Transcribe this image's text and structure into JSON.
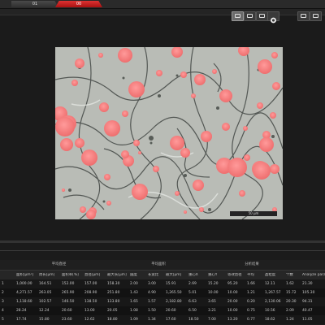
{
  "tabs": [
    {
      "label": "01"
    },
    {
      "label": "00"
    }
  ],
  "viewer": {
    "scale_label": "50 μm",
    "tool_icons": [
      "single-view-icon",
      "dual-view-icon",
      "grid-view-icon",
      "palette-icon",
      "save-image-icon",
      "settings-icon"
    ]
  },
  "table": {
    "groups": [
      "平均直径",
      "平均面积",
      "分析结果"
    ],
    "headers": [
      "",
      "面积[μm²]",
      "周长[μm]",
      "面积率[%]",
      "直径[μm]",
      "最大长[μm]",
      "圆度",
      "长宽比",
      "最大[μm]",
      "重心X",
      "重心Y",
      "等效直径",
      "平均",
      "晶粒度",
      "个数",
      "Analyze parameters"
    ],
    "rows": [
      [
        "1",
        "1,000.00",
        "164.51",
        "152.00",
        "157.00",
        "158.30",
        "2.00",
        "3.00",
        "15.91",
        "2.69",
        "15.20",
        "95.20",
        "1.66",
        "12.11",
        "1.62",
        "21.30"
      ],
      [
        "2",
        "4,271.57",
        "263.05",
        "265.90",
        "208.90",
        "251.80",
        "1.43",
        "4.90",
        "1,265.50",
        "5.01",
        "10.00",
        "10.00",
        "1.21",
        "1,267.57",
        "15.72",
        "105.30"
      ],
      [
        "3",
        "1,118.60",
        "102.57",
        "146.50",
        "138.50",
        "133.80",
        "1.65",
        "1.57",
        "2,182.80",
        "6.63",
        "3.65",
        "20.00",
        "0.20",
        "2,130.06",
        "20.30",
        "94.31"
      ],
      [
        "4",
        "28.24",
        "12.24",
        "20.60",
        "13.00",
        "20.05",
        "1.08",
        "1.50",
        "20.60",
        "6.50",
        "3.21",
        "10.00",
        "0.75",
        "10.56",
        "2.09",
        "40.47"
      ],
      [
        "5",
        "17.74",
        "15.80",
        "23.60",
        "12.62",
        "18.80",
        "1.09",
        "1.34",
        "17.60",
        "18.50",
        "7.00",
        "13.20",
        "0.77",
        "18.62",
        "1.24",
        "11.05"
      ]
    ]
  },
  "colors": {
    "particle": "#f27b7b",
    "matrix": "#b9bcb6",
    "active_tab": "#cc2222"
  }
}
